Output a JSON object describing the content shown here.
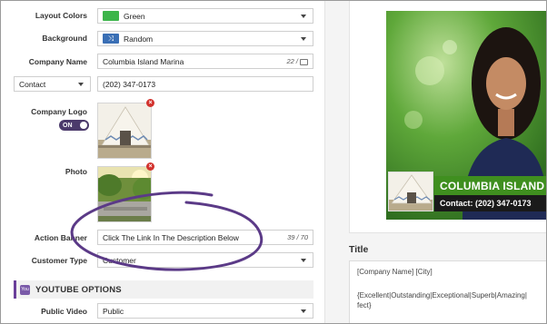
{
  "form": {
    "layout_colors": {
      "label": "Layout Colors",
      "value": "Green",
      "swatch_color": "#3cb54a"
    },
    "background": {
      "label": "Background",
      "value": "Random",
      "swatch_color": "#3a6fb5",
      "icon": "shuffle-icon"
    },
    "company_name": {
      "label": "Company Name",
      "value": "Columbia Island Marina",
      "counter": "22 /"
    },
    "contact": {
      "type_value": "Contact",
      "value": "(202) 347-0173"
    },
    "company_logo": {
      "label": "Company Logo",
      "toggle": "ON"
    },
    "photo": {
      "label": "Photo"
    },
    "action_banner": {
      "label": "Action Banner",
      "value": "Click The Link In The Description Below",
      "counter": "39 / 70"
    },
    "customer_type": {
      "label": "Customer Type",
      "value": "Customer"
    },
    "youtube_section": {
      "badge": "You",
      "title": "YOUTUBE OPTIONS"
    },
    "public_video": {
      "label": "Public Video",
      "value": "Public"
    }
  },
  "preview": {
    "company": "COLUMBIA ISLAND",
    "contact_line": "Contact: (202) 347-0173"
  },
  "title_section": {
    "heading": "Title",
    "lines": [
      "[Company Name] [City]",
      "{Excellent|Outstanding|Exceptional|Superb|Amazing|",
      "fect}"
    ]
  },
  "colors": {
    "accent_purple": "#6a3f9a",
    "annotation_circle": "#5b3a87",
    "banner_green": "#3f8f1f"
  }
}
